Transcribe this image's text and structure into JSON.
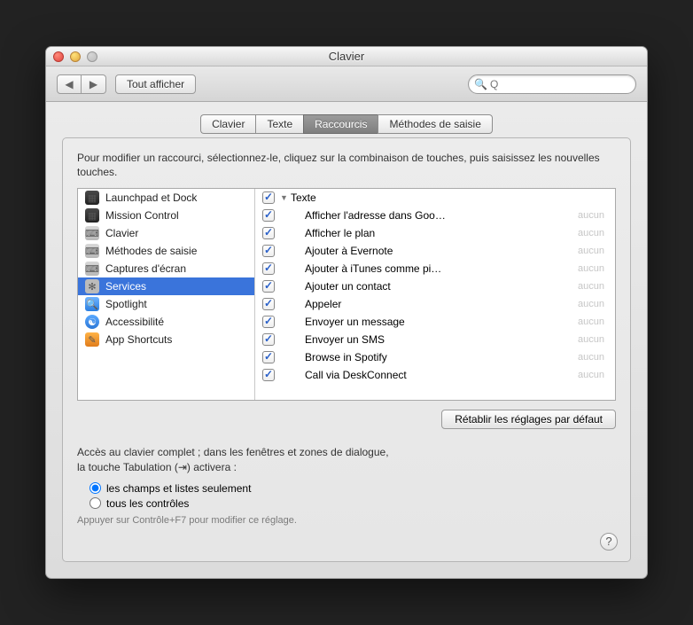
{
  "window": {
    "title": "Clavier"
  },
  "toolbar": {
    "show_all": "Tout afficher",
    "search_placeholder": "Q"
  },
  "tabs": [
    {
      "label": "Clavier",
      "active": false
    },
    {
      "label": "Texte",
      "active": false
    },
    {
      "label": "Raccourcis",
      "active": true
    },
    {
      "label": "Méthodes de saisie",
      "active": false
    }
  ],
  "instructions": "Pour modifier un raccourci, sélectionnez-le, cliquez sur la combinaison de touches, puis saisissez les nouvelles touches.",
  "categories": [
    {
      "label": "Launchpad et Dock",
      "icon": "dark"
    },
    {
      "label": "Mission Control",
      "icon": "dark"
    },
    {
      "label": "Clavier",
      "icon": "gray"
    },
    {
      "label": "Méthodes de saisie",
      "icon": "gray"
    },
    {
      "label": "Captures d'écran",
      "icon": "gray"
    },
    {
      "label": "Services",
      "icon": "gear",
      "selected": true
    },
    {
      "label": "Spotlight",
      "icon": "magnify"
    },
    {
      "label": "Accessibilité",
      "icon": "access"
    },
    {
      "label": "App Shortcuts",
      "icon": "orange"
    }
  ],
  "services_group": {
    "label": "Texte"
  },
  "services": [
    {
      "label": "Afficher l'adresse dans Goo…",
      "shortcut": "aucun"
    },
    {
      "label": "Afficher le plan",
      "shortcut": "aucun"
    },
    {
      "label": "Ajouter à Evernote",
      "shortcut": "aucun"
    },
    {
      "label": "Ajouter à iTunes comme pi…",
      "shortcut": "aucun"
    },
    {
      "label": "Ajouter un contact",
      "shortcut": "aucun"
    },
    {
      "label": "Appeler",
      "shortcut": "aucun"
    },
    {
      "label": "Envoyer un message",
      "shortcut": "aucun"
    },
    {
      "label": "Envoyer un SMS",
      "shortcut": "aucun"
    },
    {
      "label": "Browse in Spotify",
      "shortcut": "aucun"
    },
    {
      "label": "Call via DeskConnect",
      "shortcut": "aucun"
    }
  ],
  "restore_button": "Rétablir les réglages par défaut",
  "full_access": {
    "line1": "Accès au clavier complet ; dans les fenêtres et zones de dialogue,",
    "line2": "la touche Tabulation (⇥) activera :",
    "opt1": "les champs et listes seulement",
    "opt2": "tous les contrôles",
    "hint": "Appuyer sur Contrôle+F7 pour modifier ce réglage."
  }
}
